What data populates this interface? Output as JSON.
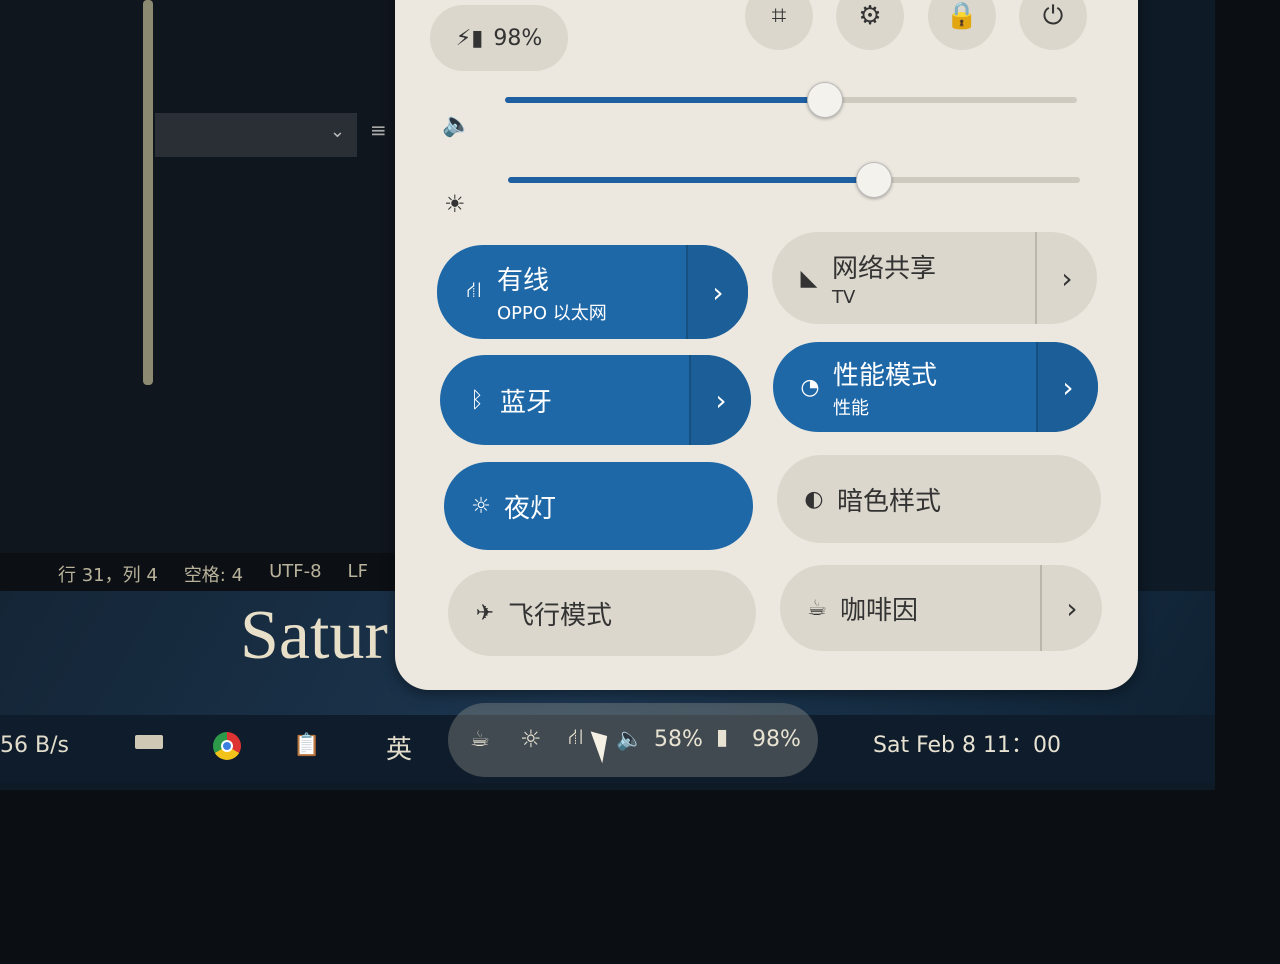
{
  "editor": {
    "status": [
      "行 31，列 4",
      "空格: 4",
      "UTF-8",
      "LF",
      "{"
    ],
    "dropdown_chevron": "⌄",
    "wallpaper_text": "Satur"
  },
  "taskbar": {
    "net_speed": "56 B/s",
    "input_method": "英",
    "volume": "58%",
    "battery": "98%",
    "clock": "Sat Feb 8  11：00"
  },
  "quick_settings": {
    "battery": "98%",
    "volume_level": 0.56,
    "brightness_level": 0.64,
    "accent": "#1f68a8",
    "tiles": [
      {
        "title": "有线",
        "subtitle": "OPPO 以太网",
        "icon": "network-wired-icon",
        "on": true,
        "arrow": true
      },
      {
        "title": "网络共享",
        "subtitle": "TV",
        "icon": "hotspot-icon",
        "on": false,
        "arrow": true
      },
      {
        "title": "蓝牙",
        "subtitle": "",
        "icon": "bluetooth-icon",
        "on": true,
        "arrow": true
      },
      {
        "title": "性能模式",
        "subtitle": "性能",
        "icon": "power-profile-icon",
        "on": true,
        "arrow": true
      },
      {
        "title": "夜灯",
        "subtitle": "",
        "icon": "night-light-icon",
        "on": true,
        "arrow": false
      },
      {
        "title": "暗色样式",
        "subtitle": "",
        "icon": "dark-style-icon",
        "on": false,
        "arrow": false
      },
      {
        "title": "飞行模式",
        "subtitle": "",
        "icon": "airplane-icon",
        "on": false,
        "arrow": false
      },
      {
        "title": "咖啡因",
        "subtitle": "",
        "icon": "caffeine-icon",
        "on": false,
        "arrow": true
      }
    ]
  }
}
